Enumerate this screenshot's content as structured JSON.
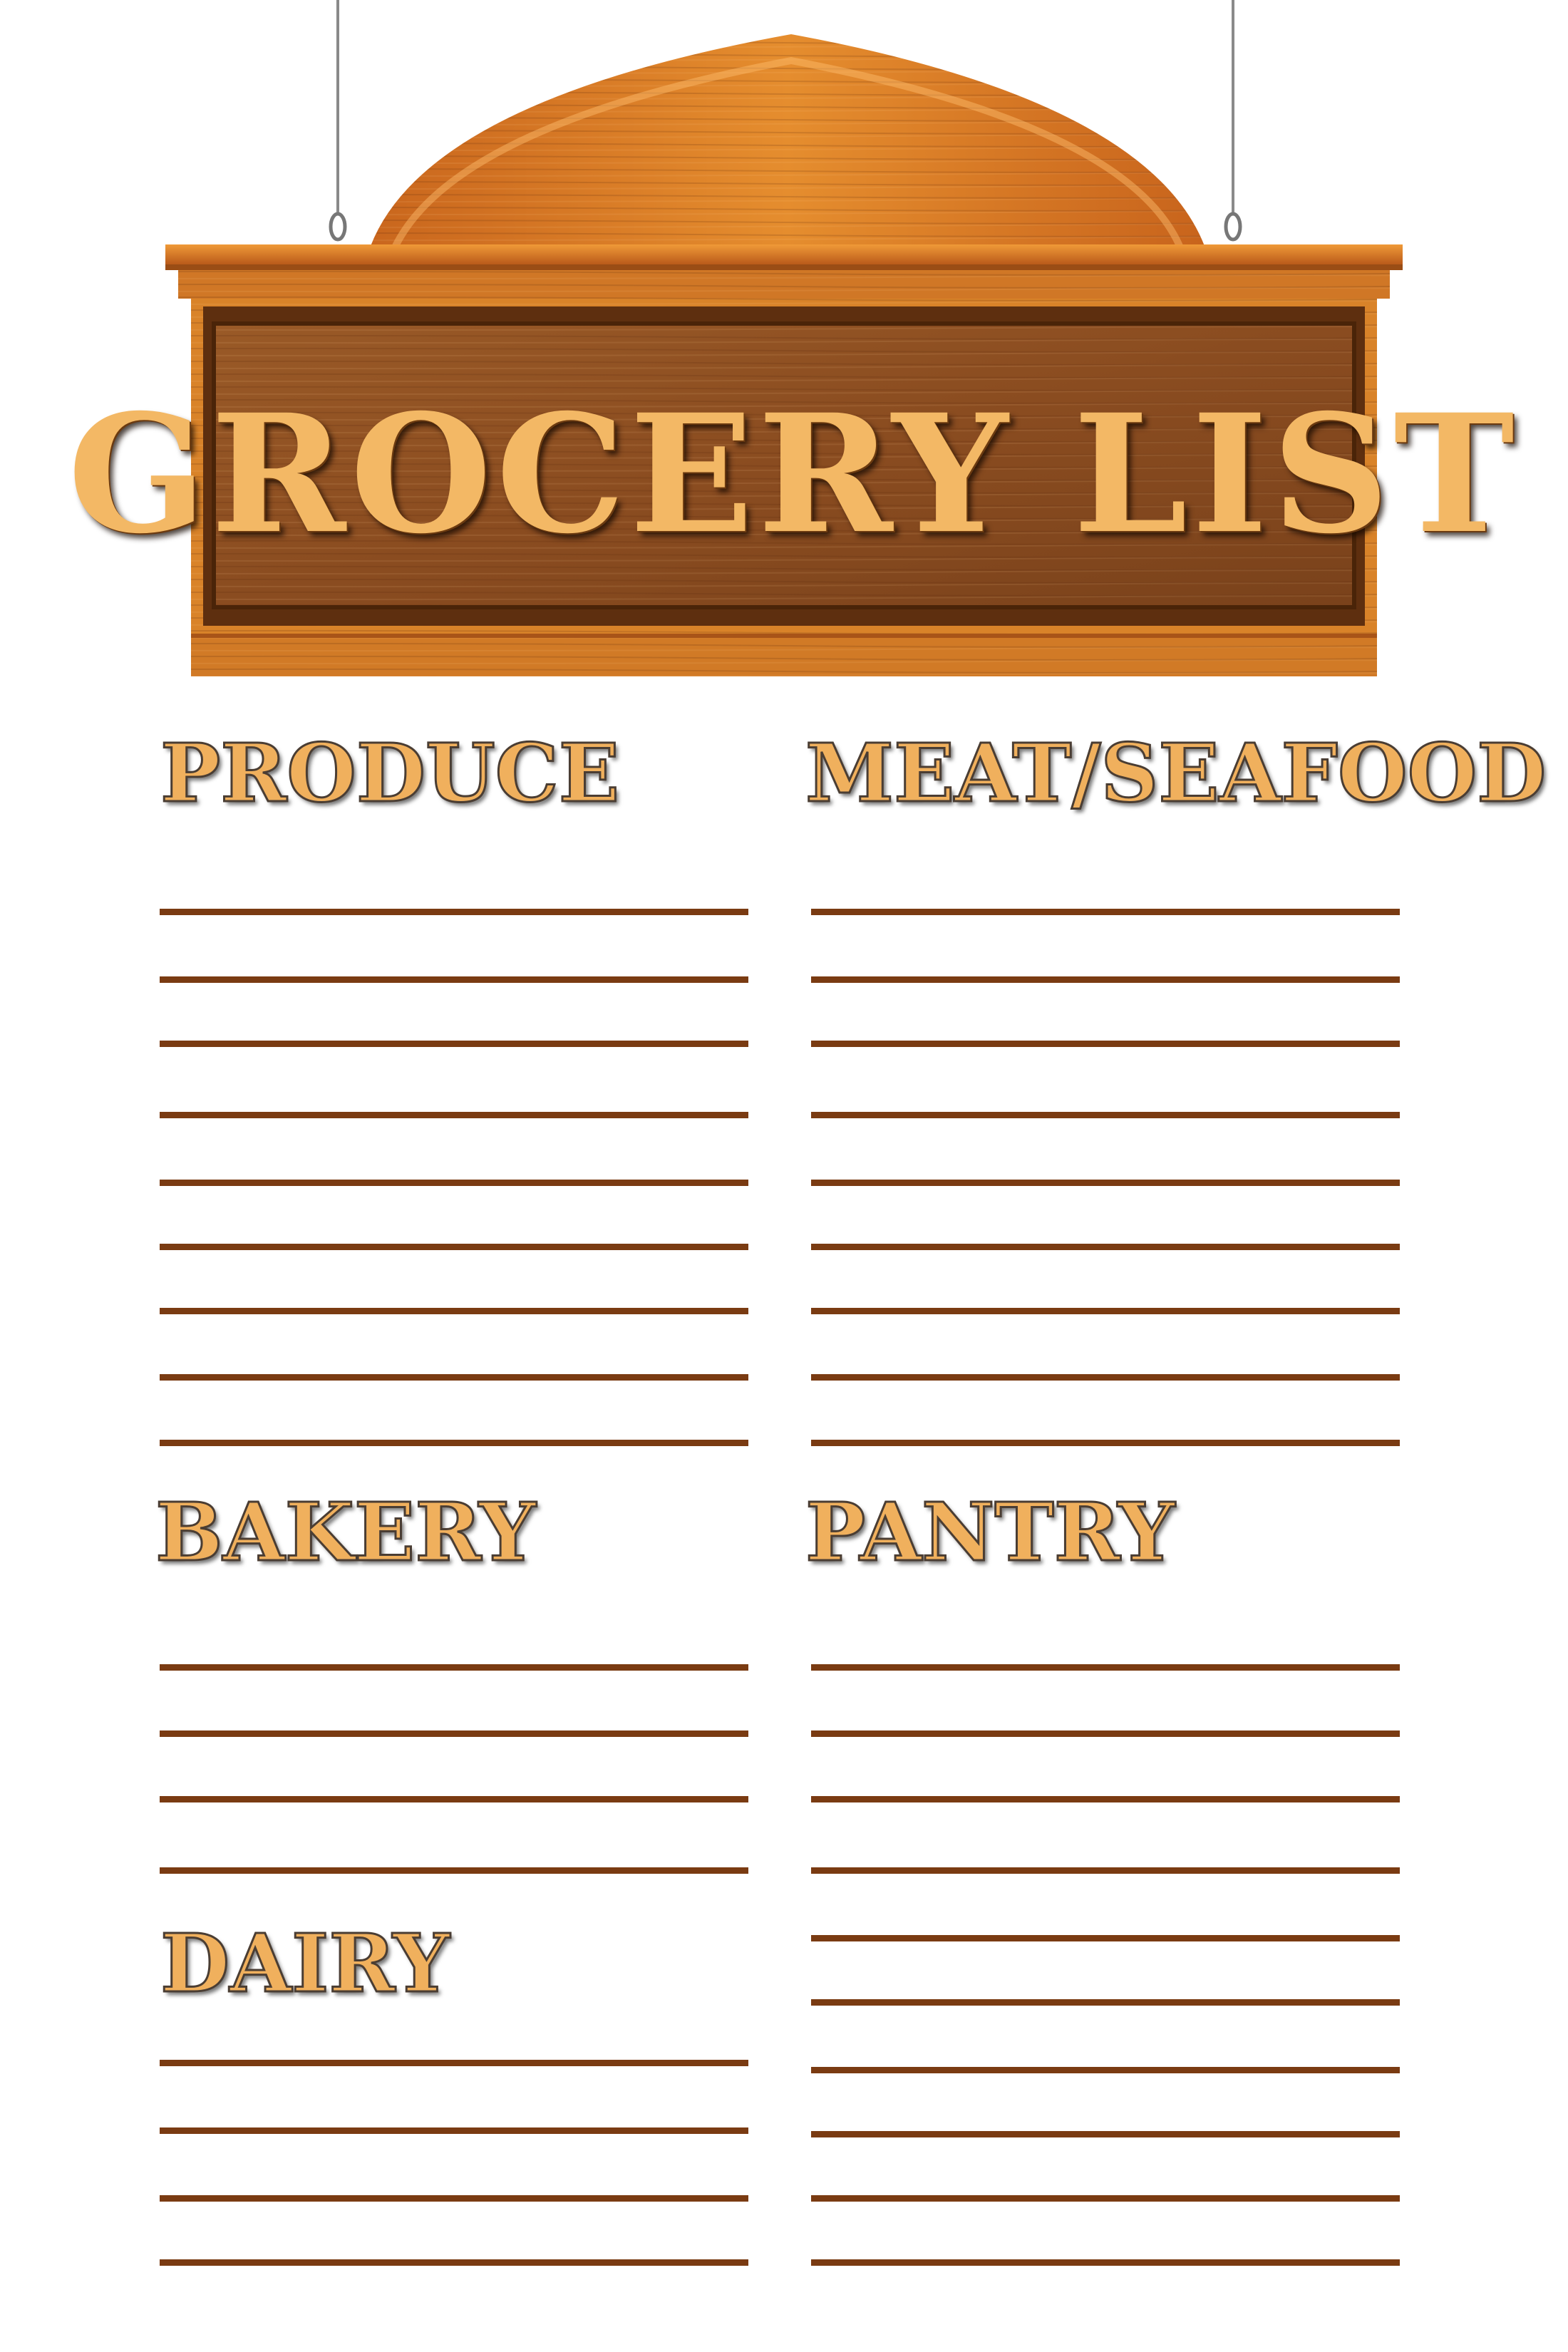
{
  "sign": {
    "title": "GROCERY LIST",
    "colors": {
      "wood_light": "#e08a2c",
      "wood_dark": "#7c4418",
      "panel": "#8a4f22",
      "text": "#f3b865"
    }
  },
  "sections": [
    {
      "id": "produce",
      "title": "PRODUCE",
      "line_count": 9
    },
    {
      "id": "meat-seafood",
      "title": "MEAT/SEAFOOD",
      "line_count": 9
    },
    {
      "id": "bakery",
      "title": "BAKERY",
      "line_count": 4
    },
    {
      "id": "pantry",
      "title": "PANTRY",
      "line_count": 10
    },
    {
      "id": "dairy",
      "title": "DAIRY",
      "line_count": 4
    }
  ],
  "colors": {
    "line": "#7a3b12",
    "heading": "#f0b05d",
    "background": "#ffffff"
  }
}
